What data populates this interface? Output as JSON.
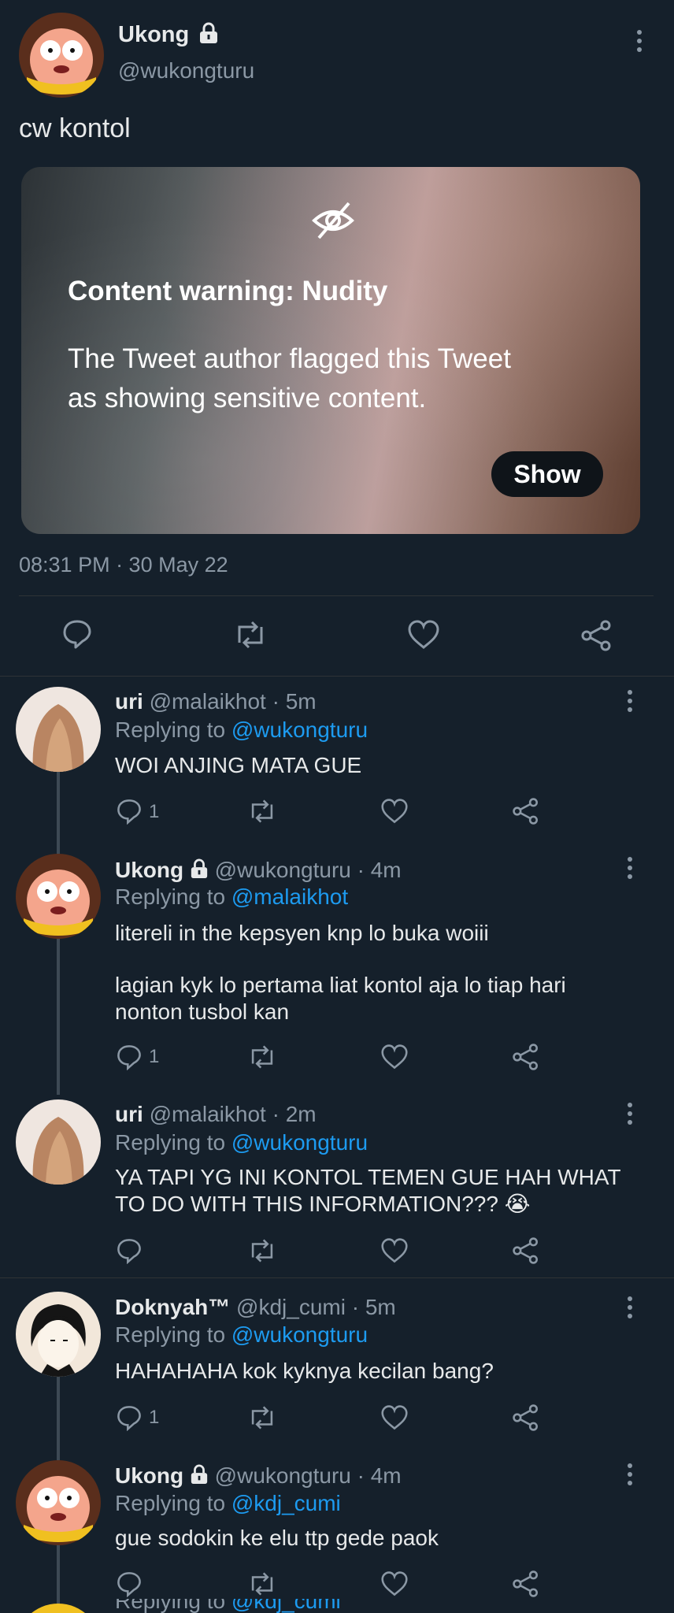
{
  "main_tweet": {
    "author_name": "Ukong",
    "author_handle": "@wukongturu",
    "text": "cw kontol",
    "media_warning": {
      "title": "Content warning: Nudity",
      "body_line1": "The Tweet author flagged this Tweet",
      "body_line2": "as showing sensitive content.",
      "show_label": "Show"
    },
    "timestamp": "08:31 PM · 30 May 22"
  },
  "replies": [
    {
      "author_name": "uri",
      "meta": "@malaikhot · 5m",
      "replying_prefix": "Replying to",
      "replying_to": "@wukongturu",
      "text_lines": [
        "WOI ANJING MATA GUE"
      ],
      "reply_count": "1"
    },
    {
      "author_name": "Ukong",
      "meta": "@wukongturu · 4m",
      "replying_prefix": "Replying to",
      "replying_to": "@malaikhot",
      "text_lines": [
        "litereli in the kepsyen knp lo buka woiii",
        "lagian kyk lo pertama liat kontol aja lo tiap hari",
        "nonton tusbol kan"
      ],
      "reply_count": "1"
    },
    {
      "author_name": "uri",
      "meta": "@malaikhot · 2m",
      "replying_prefix": "Replying to",
      "replying_to": "@wukongturu",
      "text_lines": [
        "YA TAPI YG INI KONTOL TEMEN GUE HAH WHAT",
        "TO DO WITH THIS INFORMATION??? 😭"
      ],
      "reply_count": ""
    },
    {
      "author_name": "Doknyah™",
      "meta": "@kdj_cumi · 5m",
      "replying_prefix": "Replying to",
      "replying_to": "@wukongturu",
      "text_lines": [
        "HAHAHAHA kok kyknya kecilan bang?"
      ],
      "reply_count": "1"
    },
    {
      "author_name": "Ukong",
      "meta": "@wukongturu · 4m",
      "replying_prefix": "Replying to",
      "replying_to": "@kdj_cumi",
      "text_lines": [
        "gue sodokin ke elu ttp gede paok"
      ],
      "reply_count": ""
    }
  ],
  "cutoff": {
    "replying_prefix": "Replying to",
    "replying_to": "@kdj_cumi"
  },
  "colors": {
    "background": "#15202b",
    "accent": "#1d9bf0",
    "muted": "#8b98a5"
  },
  "icons": [
    "lock-icon",
    "more-icon",
    "eye-slash-icon",
    "reply-icon",
    "retweet-icon",
    "like-icon",
    "share-icon"
  ]
}
